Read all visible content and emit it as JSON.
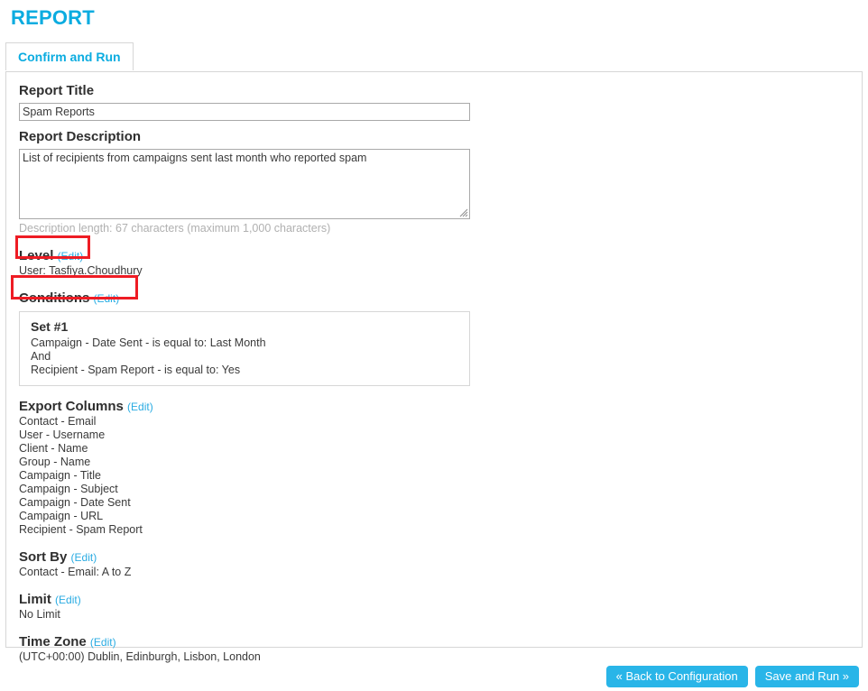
{
  "page": {
    "heading": "REPORT"
  },
  "tabs": [
    {
      "label": "Confirm and Run",
      "active": true
    }
  ],
  "form": {
    "report_title": {
      "label": "Report Title",
      "value": "Spam Reports",
      "placeholder": ""
    },
    "report_description": {
      "label": "Report Description",
      "value": "List of recipients from campaigns sent last month who reported spam",
      "placeholder": "",
      "helper": "Description length: 67 characters (maximum 1,000 characters)",
      "length": 67,
      "max_length": 1000
    }
  },
  "sections": {
    "level": {
      "title": "Level",
      "edit_label": "Edit",
      "open_paren": "(",
      "close_paren": ")",
      "value": "User: Tasfiya.Choudhury",
      "highlighted": true
    },
    "conditions": {
      "title": "Conditions",
      "edit_label": "Edit",
      "open_paren": "(",
      "close_paren": ")",
      "highlighted": true,
      "set_title": "Set #1",
      "lines": [
        "Campaign - Date Sent - is equal to: Last Month",
        "And",
        "Recipient - Spam Report - is equal to: Yes"
      ]
    },
    "export_columns": {
      "title": "Export Columns",
      "edit_label": "Edit",
      "open_paren": "(",
      "close_paren": ")",
      "items": [
        "Contact - Email",
        "User - Username",
        "Client - Name",
        "Group - Name",
        "Campaign - Title",
        "Campaign - Subject",
        "Campaign - Date Sent",
        "Campaign - URL",
        "Recipient - Spam Report"
      ]
    },
    "sort_by": {
      "title": "Sort By",
      "edit_label": "Edit",
      "open_paren": "(",
      "close_paren": ")",
      "value": "Contact - Email: A to Z"
    },
    "limit": {
      "title": "Limit",
      "edit_label": "Edit",
      "open_paren": "(",
      "close_paren": ")",
      "value": "No Limit"
    },
    "time_zone": {
      "title": "Time Zone",
      "edit_label": "Edit",
      "open_paren": "(",
      "close_paren": ")",
      "value": "(UTC+00:00) Dublin, Edinburgh, Lisbon, London"
    }
  },
  "footer": {
    "back_button": "« Back to Configuration",
    "save_button": "Save and Run »"
  },
  "colors": {
    "accent_blue": "#0bace0",
    "link_blue": "#29abe2",
    "button_blue": "#29b5e8",
    "annotation_red": "#ee1c24",
    "border_gray": "#d6d6d6",
    "input_border": "#a9a9a9",
    "helper_gray": "#b0b0b0",
    "text_dark": "#3a3a3a"
  }
}
